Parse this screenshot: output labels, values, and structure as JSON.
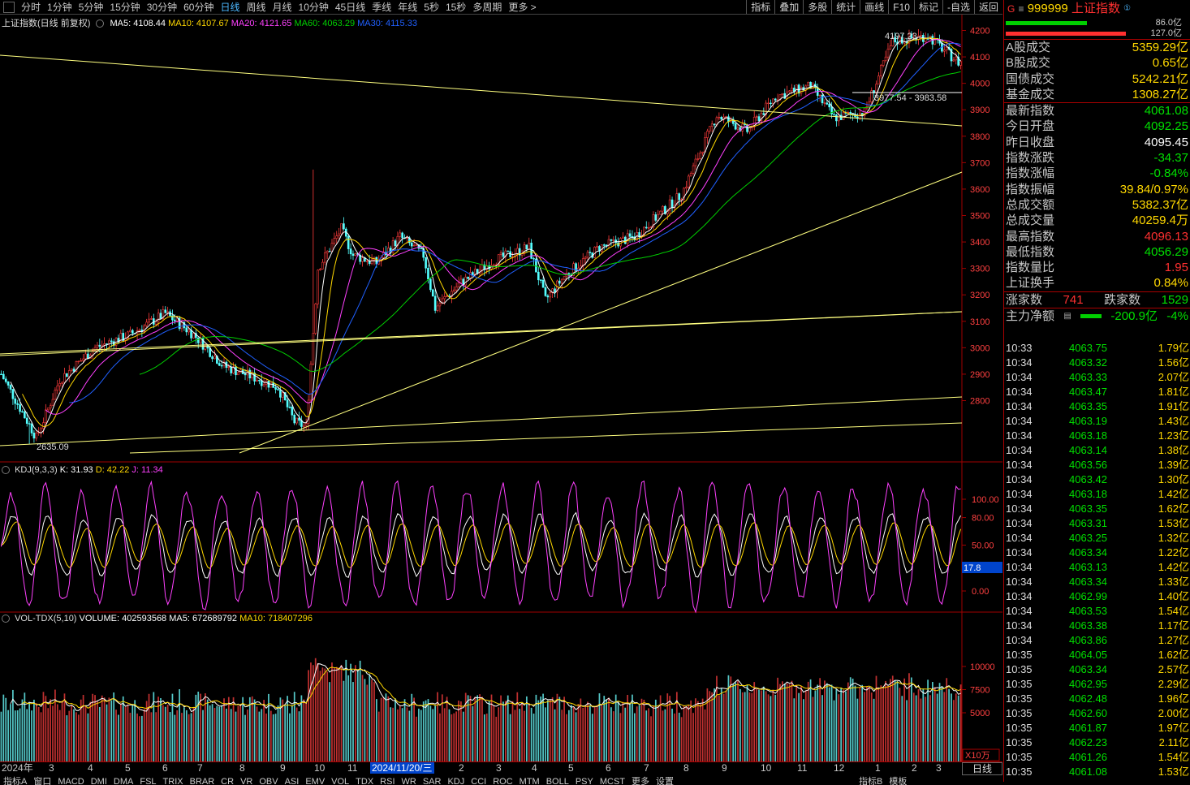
{
  "periods": [
    "分时",
    "1分钟",
    "5分钟",
    "15分钟",
    "30分钟",
    "60分钟",
    "日线",
    "周线",
    "月线",
    "10分钟",
    "45日线",
    "季线",
    "年线",
    "5秒",
    "15秒",
    "多周期",
    "更多 >"
  ],
  "tools": [
    "指标",
    "叠加",
    "多股",
    "统计",
    "画线",
    "F10",
    "标记",
    "-自选",
    "返回"
  ],
  "main_label": {
    "name": "上证指数(日线 前复权)",
    "ma5": "MA5: 4108.44",
    "ma10": "MA10: 4107.67",
    "ma20": "MA20: 4121.65",
    "ma60": "MA60: 4063.29",
    "ma30": "MA30: 4115.33"
  },
  "kdj_label": {
    "name": "KDJ(9,3,3)",
    "k": "K: 31.93",
    "d": "D: 42.22",
    "j": "J: 11.34"
  },
  "vol_label": {
    "name": "VOL-TDX(5,10)",
    "volume": "VOLUME: 402593568",
    "ma5": "MA5: 672689792",
    "ma10": "MA10: 718407296"
  },
  "price_axis": [
    "4200",
    "4100",
    "4000",
    "3900",
    "3800",
    "3700",
    "3600",
    "3500",
    "3400",
    "3300",
    "3200",
    "3100",
    "3000",
    "2900",
    "2800"
  ],
  "kdj_axis": [
    "100.00",
    "80.00",
    "50.00",
    "0.00"
  ],
  "kdj_current": "17.8",
  "vol_axis": [
    "10000",
    "7500",
    "5000"
  ],
  "vol_unit": "X10万",
  "annotations": {
    "high": "4197.23",
    "low": "2635.09",
    "range": "3977.54 - 3983.58"
  },
  "dates": [
    "2024年",
    "3",
    "4",
    "5",
    "6",
    "7",
    "8",
    "9",
    "10",
    "11",
    "2024/11/20/三",
    "2",
    "3",
    "4",
    "5",
    "6",
    "7",
    "8",
    "9",
    "10",
    "11",
    "12",
    "1",
    "2",
    "3"
  ],
  "day_label": "日线",
  "indicator_tabs": [
    "指标A",
    "窗口",
    "MACD",
    "DMI",
    "DMA",
    "FSL",
    "TRIX",
    "BRAR",
    "CR",
    "VR",
    "OBV",
    "ASI",
    "EMV",
    "VOL",
    "TDX",
    "RSI",
    "WR",
    "SAR",
    "KDJ",
    "CCI",
    "ROC",
    "MTM",
    "BOLL",
    "PSY",
    "MCST",
    "更多",
    "设置"
  ],
  "indicator_right": [
    "指标B",
    "模板"
  ],
  "quote": {
    "g": "G",
    "code": "999999",
    "name": "上证指数",
    "bar1_val": "86.0亿",
    "bar2_val": "127.0亿",
    "rows1": [
      {
        "k": "A股成交",
        "v": "5359.29亿"
      },
      {
        "k": "B股成交",
        "v": "0.65亿"
      },
      {
        "k": "国债成交",
        "v": "5242.21亿"
      },
      {
        "k": "基金成交",
        "v": "1308.27亿"
      }
    ],
    "rows2": [
      {
        "k": "最新指数",
        "v": "4061.08",
        "c": "green"
      },
      {
        "k": "今日开盘",
        "v": "4092.25",
        "c": "green"
      },
      {
        "k": "昨日收盘",
        "v": "4095.45",
        "c": "wht"
      },
      {
        "k": "指数涨跌",
        "v": "-34.37",
        "c": "green"
      },
      {
        "k": "指数涨幅",
        "v": "-0.84%",
        "c": "green"
      },
      {
        "k": "指数振幅",
        "v": "39.84/0.97%",
        "c": "yel"
      },
      {
        "k": "总成交额",
        "v": "5382.37亿",
        "c": "yel"
      },
      {
        "k": "总成交量",
        "v": "40259.4万",
        "c": "yel"
      },
      {
        "k": "最高指数",
        "v": "4096.13",
        "c": "red"
      },
      {
        "k": "最低指数",
        "v": "4056.29",
        "c": "green"
      },
      {
        "k": "指数量比",
        "v": "1.95",
        "c": "red"
      },
      {
        "k": "上证换手",
        "v": "0.84%",
        "c": "yel"
      }
    ],
    "up_label": "涨家数",
    "up": "741",
    "down_label": "跌家数",
    "down": "1529",
    "flow_label": "主力净额",
    "flow": "-200.9亿",
    "flow_pct": "-4%"
  },
  "ticks": [
    {
      "t": "10:33",
      "p": "4063.75",
      "v": "1.79亿"
    },
    {
      "t": "10:34",
      "p": "4063.32",
      "v": "1.56亿"
    },
    {
      "t": "10:34",
      "p": "4063.33",
      "v": "2.07亿"
    },
    {
      "t": "10:34",
      "p": "4063.47",
      "v": "1.81亿"
    },
    {
      "t": "10:34",
      "p": "4063.35",
      "v": "1.91亿"
    },
    {
      "t": "10:34",
      "p": "4063.19",
      "v": "1.43亿"
    },
    {
      "t": "10:34",
      "p": "4063.18",
      "v": "1.23亿"
    },
    {
      "t": "10:34",
      "p": "4063.14",
      "v": "1.38亿"
    },
    {
      "t": "10:34",
      "p": "4063.56",
      "v": "1.39亿"
    },
    {
      "t": "10:34",
      "p": "4063.42",
      "v": "1.30亿"
    },
    {
      "t": "10:34",
      "p": "4063.18",
      "v": "1.42亿"
    },
    {
      "t": "10:34",
      "p": "4063.35",
      "v": "1.62亿"
    },
    {
      "t": "10:34",
      "p": "4063.31",
      "v": "1.53亿"
    },
    {
      "t": "10:34",
      "p": "4063.25",
      "v": "1.32亿"
    },
    {
      "t": "10:34",
      "p": "4063.34",
      "v": "1.22亿"
    },
    {
      "t": "10:34",
      "p": "4063.13",
      "v": "1.42亿"
    },
    {
      "t": "10:34",
      "p": "4063.34",
      "v": "1.33亿"
    },
    {
      "t": "10:34",
      "p": "4062.99",
      "v": "1.40亿"
    },
    {
      "t": "10:34",
      "p": "4063.53",
      "v": "1.54亿"
    },
    {
      "t": "10:34",
      "p": "4063.38",
      "v": "1.17亿"
    },
    {
      "t": "10:34",
      "p": "4063.86",
      "v": "1.27亿"
    },
    {
      "t": "10:35",
      "p": "4064.05",
      "v": "1.62亿"
    },
    {
      "t": "10:35",
      "p": "4063.34",
      "v": "2.57亿"
    },
    {
      "t": "10:35",
      "p": "4062.95",
      "v": "2.29亿"
    },
    {
      "t": "10:35",
      "p": "4062.48",
      "v": "1.96亿"
    },
    {
      "t": "10:35",
      "p": "4062.60",
      "v": "2.00亿"
    },
    {
      "t": "10:35",
      "p": "4061.87",
      "v": "1.97亿"
    },
    {
      "t": "10:35",
      "p": "4062.23",
      "v": "2.11亿"
    },
    {
      "t": "10:35",
      "p": "4061.26",
      "v": "1.54亿"
    },
    {
      "t": "10:35",
      "p": "4061.08",
      "v": "1.53亿"
    }
  ],
  "colors": {
    "up": "#ff3c3c",
    "down": "#54ffff",
    "ma5": "#ffffff",
    "ma10": "#ffd800",
    "ma20": "#ff40ff",
    "ma60": "#00d000",
    "ma30": "#2060ff",
    "grid": "#a00000"
  },
  "chart_data": {
    "type": "candlestick",
    "title": "上证指数(日线 前复权)",
    "ylim": [
      2600,
      4250
    ],
    "key_points": [
      {
        "label": "2024年",
        "close": 2900
      },
      {
        "label": "2635.09 low",
        "close": 2635.09
      },
      {
        "label": "3",
        "close": 2900
      },
      {
        "label": "5",
        "close": 3150
      },
      {
        "label": "7",
        "close": 2950
      },
      {
        "label": "9",
        "close": 2700
      },
      {
        "label": "10",
        "close": 3400
      },
      {
        "label": "11",
        "close": 3450
      },
      {
        "label": "2024/11/20/三",
        "close": 3300
      },
      {
        "label": "3",
        "close": 3350
      },
      {
        "label": "4",
        "close": 3100
      },
      {
        "label": "6",
        "close": 3400
      },
      {
        "label": "8",
        "close": 3700
      },
      {
        "label": "9",
        "close": 3900
      },
      {
        "label": "10",
        "close": 4000
      },
      {
        "label": "12",
        "close": 3900
      },
      {
        "label": "1",
        "close": 4150
      },
      {
        "label": "4197.23 high",
        "close": 4197.23
      },
      {
        "label": "3",
        "close": 4061.08
      }
    ]
  }
}
